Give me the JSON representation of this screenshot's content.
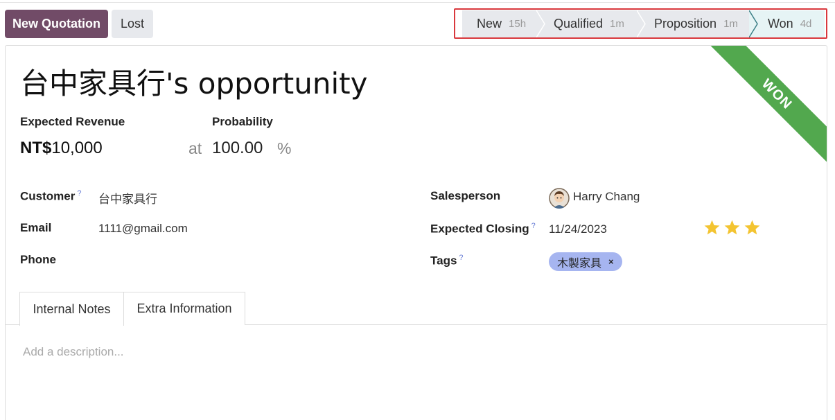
{
  "toolbar": {
    "new_quotation_label": "New Quotation",
    "lost_label": "Lost"
  },
  "statusbar": {
    "stages": [
      {
        "name": "New",
        "duration": "15h"
      },
      {
        "name": "Qualified",
        "duration": "1m"
      },
      {
        "name": "Proposition",
        "duration": "1m"
      },
      {
        "name": "Won",
        "duration": "4d"
      }
    ],
    "active_stage": "Won"
  },
  "ribbon": {
    "text": "WON",
    "color": "#52a84e"
  },
  "record": {
    "title": "台中家具行's opportunity",
    "expected_revenue_label": "Expected Revenue",
    "currency": "NT$",
    "expected_revenue": "10,000",
    "at_label": "at",
    "probability_label": "Probability",
    "probability": "100.00",
    "percent_sign": "%"
  },
  "fields_left": {
    "customer_label": "Customer",
    "customer_help": "?",
    "customer_value": "台中家具行",
    "email_label": "Email",
    "email_value": "1111@gmail.com",
    "phone_label": "Phone",
    "phone_value": ""
  },
  "fields_right": {
    "salesperson_label": "Salesperson",
    "salesperson_value": "Harry Chang",
    "salesperson_avatar_icon": "user-avatar-icon",
    "expected_closing_label": "Expected Closing",
    "expected_closing_help": "?",
    "expected_closing_value": "11/24/2023",
    "tags_label": "Tags",
    "tags_help": "?",
    "tags": [
      {
        "label": "木製家具",
        "remove": "×",
        "color": "#a6b5f0"
      }
    ]
  },
  "priority": {
    "stars_filled": 3,
    "stars_total": 3,
    "star_color": "#f3c431"
  },
  "tabs": [
    {
      "label": "Internal Notes",
      "active": true
    },
    {
      "label": "Extra Information",
      "active": false
    }
  ],
  "notes": {
    "placeholder": "Add a description..."
  },
  "colors": {
    "brand": "#714b67",
    "highlight_outline": "#d9383d"
  }
}
